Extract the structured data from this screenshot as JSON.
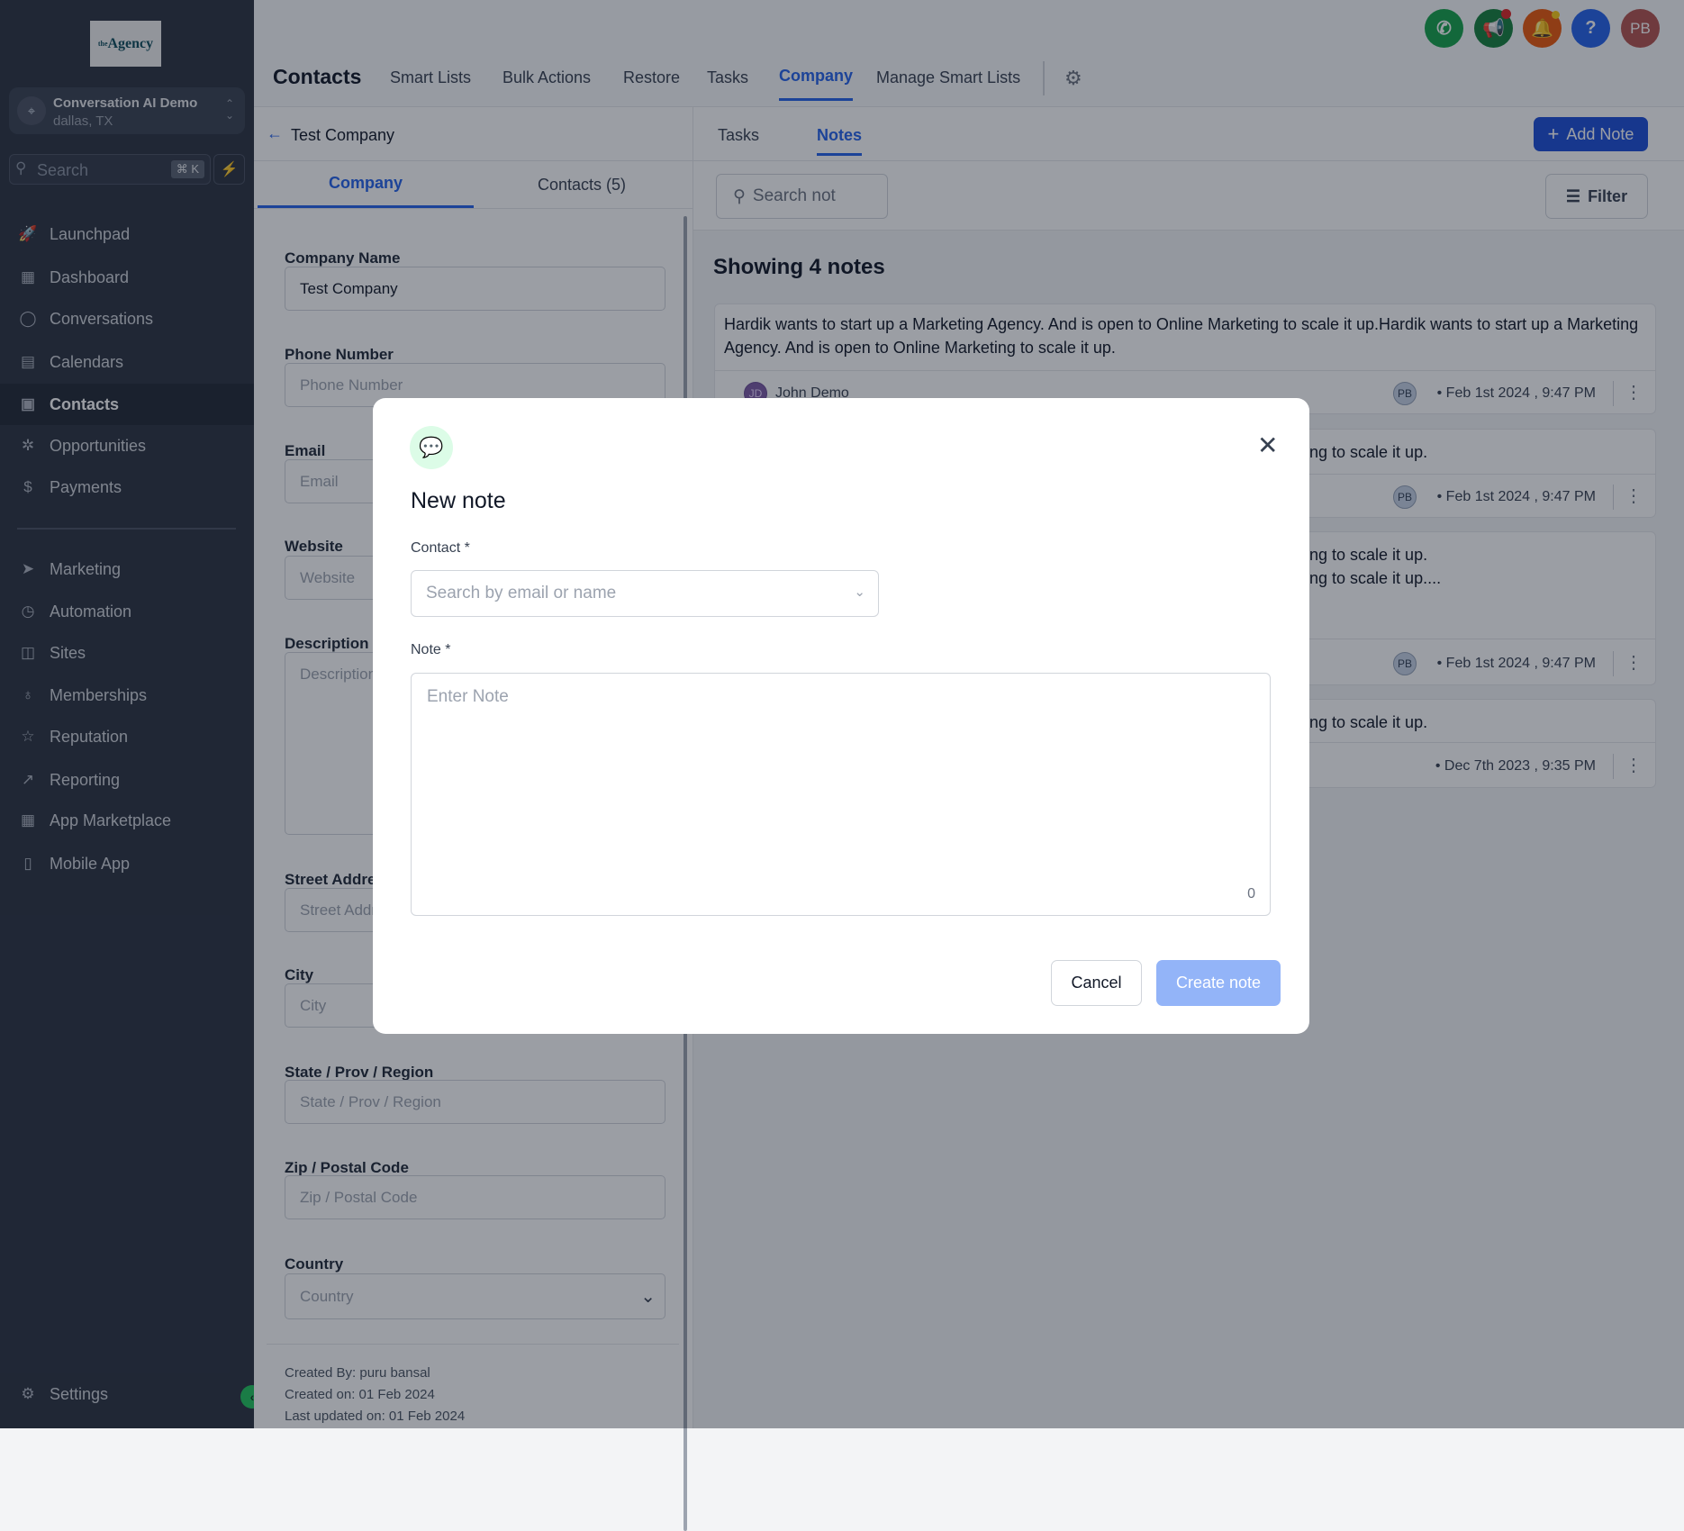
{
  "sidebar": {
    "logo_text": "the Agency",
    "location": {
      "name": "Conversation AI Demo",
      "sub": "dallas, TX"
    },
    "search": {
      "placeholder": "Search",
      "shortcut": "⌘ K"
    },
    "items": [
      {
        "label": "Launchpad",
        "icon": "rocket-icon"
      },
      {
        "label": "Dashboard",
        "icon": "grid-icon"
      },
      {
        "label": "Conversations",
        "icon": "chat-icon"
      },
      {
        "label": "Calendars",
        "icon": "calendar-icon"
      },
      {
        "label": "Contacts",
        "icon": "contacts-icon",
        "active": true
      },
      {
        "label": "Opportunities",
        "icon": "opportunities-icon"
      },
      {
        "label": "Payments",
        "icon": "payments-icon"
      },
      {
        "label": "Marketing",
        "icon": "send-icon"
      },
      {
        "label": "Automation",
        "icon": "automation-icon"
      },
      {
        "label": "Sites",
        "icon": "sites-icon"
      },
      {
        "label": "Memberships",
        "icon": "award-icon"
      },
      {
        "label": "Reputation",
        "icon": "star-icon"
      },
      {
        "label": "Reporting",
        "icon": "trend-icon"
      },
      {
        "label": "App Marketplace",
        "icon": "apps-icon"
      },
      {
        "label": "Mobile App",
        "icon": "mobile-icon"
      }
    ],
    "settings": "Settings"
  },
  "header": {
    "title": "Contacts",
    "tabs": [
      "Smart Lists",
      "Bulk Actions",
      "Restore",
      "Tasks",
      "Company",
      "Manage Smart Lists"
    ],
    "active_tab": "Company",
    "avatar": "PB",
    "colors": {
      "phone": "#16a34a",
      "announce": "#15803d",
      "bell": "#ea580c",
      "help": "#2563eb",
      "avatar": "#b45450"
    }
  },
  "company": {
    "back_label": "Test Company",
    "tabs": [
      "Company",
      "Contacts (5)"
    ],
    "fields": [
      {
        "label": "Company Name",
        "value": "Test Company",
        "placeholder": ""
      },
      {
        "label": "Phone Number",
        "value": "",
        "placeholder": "Phone Number"
      },
      {
        "label": "Email",
        "value": "",
        "placeholder": "Email"
      },
      {
        "label": "Website",
        "value": "",
        "placeholder": "Website"
      },
      {
        "label": "Description",
        "value": "",
        "placeholder": "Description"
      },
      {
        "label": "Street Address",
        "value": "",
        "placeholder": "Street Address"
      },
      {
        "label": "City",
        "value": "",
        "placeholder": "City"
      },
      {
        "label": "State / Prov / Region",
        "value": "",
        "placeholder": "State / Prov / Region"
      },
      {
        "label": "Zip / Postal Code",
        "value": "",
        "placeholder": "Zip / Postal Code"
      },
      {
        "label": "Country",
        "value": "",
        "placeholder": "Country"
      }
    ],
    "created_by": "Created By: puru bansal",
    "created_on": "Created on: 01 Feb 2024",
    "updated_on": "Last updated on: 01 Feb 2024"
  },
  "notes": {
    "tabs": [
      "Tasks",
      "Notes"
    ],
    "active_tab": "Notes",
    "add_label": "Add Note",
    "search_placeholder": "Search not",
    "filter_label": "Filter",
    "count_label": "Showing 4 notes",
    "items": [
      {
        "text": "Hardik wants to start up a Marketing Agency. And is open to Online Marketing to scale it up.Hardik wants to start up a Marketing Agency. And is open to Online Marketing to scale it up.",
        "contact": "John Demo",
        "contact_initials": "JD",
        "author": "PB",
        "date": "Feb 1st 2024 , 9:47 PM"
      },
      {
        "text": "ng to scale it up.",
        "author": "PB",
        "date": "Feb 1st 2024 , 9:47 PM"
      },
      {
        "text": "ng to scale it up.",
        "text2": "ng to scale it up....",
        "author": "PB",
        "date": "Feb 1st 2024 , 9:47 PM"
      },
      {
        "text": "ng to scale it up.",
        "author": "",
        "date": "Dec 7th 2023 , 9:35 PM"
      }
    ]
  },
  "modal": {
    "title": "New note",
    "contact_label": "Contact *",
    "contact_placeholder": "Search by email or name",
    "note_label": "Note *",
    "note_placeholder": "Enter Note",
    "char_count": "0",
    "cancel": "Cancel",
    "create": "Create note",
    "accent": "#22c55e"
  }
}
